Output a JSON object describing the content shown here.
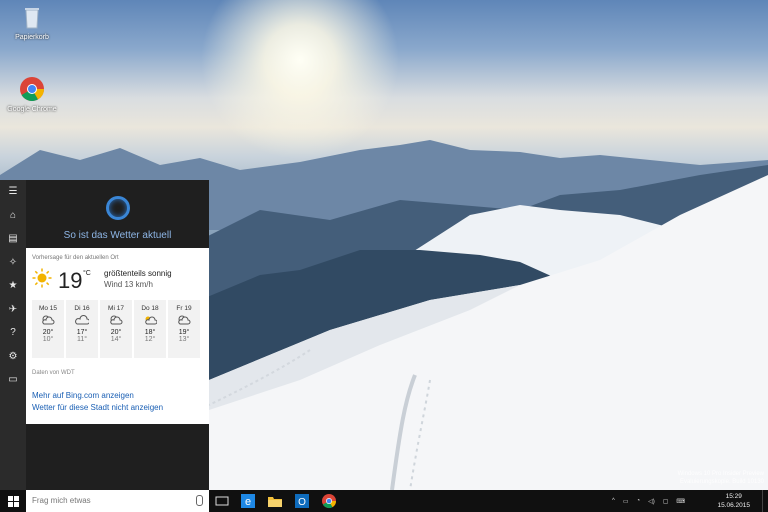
{
  "desktop": {
    "icons": [
      {
        "label": "Papierkorb"
      },
      {
        "label": "Google Chrome"
      }
    ],
    "watermark": {
      "line1": "Windows 10 Pro Insider Preview",
      "line2": "Evaluierungskopie. Build 10130"
    }
  },
  "cortana": {
    "question": "So ist das Wetter aktuell",
    "card": {
      "location_label": "Vorhersage für den aktuellen Ort",
      "temperature": "19",
      "unit": "°C",
      "condition": "größtenteils sonnig",
      "wind": "Wind 13 km/h",
      "forecast": [
        {
          "day": "Mo 15",
          "high": "20°",
          "low": "10°",
          "icon": "partly-cloudy-icon"
        },
        {
          "day": "Di 16",
          "high": "17°",
          "low": "11°",
          "icon": "cloud-icon"
        },
        {
          "day": "Mi 17",
          "high": "20°",
          "low": "14°",
          "icon": "partly-cloudy-icon"
        },
        {
          "day": "Do 18",
          "high": "18°",
          "low": "12°",
          "icon": "sun-cloud-icon"
        },
        {
          "day": "Fr 19",
          "high": "19°",
          "low": "13°",
          "icon": "partly-cloudy-icon"
        }
      ],
      "source": "Daten von WDT",
      "link_bing": "Mehr auf Bing.com anzeigen",
      "link_hide": "Wetter für diese Stadt nicht anzeigen"
    },
    "rail_icons": [
      "hamburger-icon",
      "home-icon",
      "notebook-icon",
      "lightbulb-icon",
      "star-icon",
      "flight-icon",
      "help-icon",
      "settings-icon",
      "feedback-icon"
    ]
  },
  "taskbar": {
    "search_placeholder": "Frag mich etwas",
    "pinned": [
      "task-view-icon",
      "internet-explorer-icon",
      "file-explorer-icon",
      "outlook-icon",
      "chrome-icon"
    ],
    "clock_time": "15:29",
    "clock_date": "15.06.2015"
  }
}
